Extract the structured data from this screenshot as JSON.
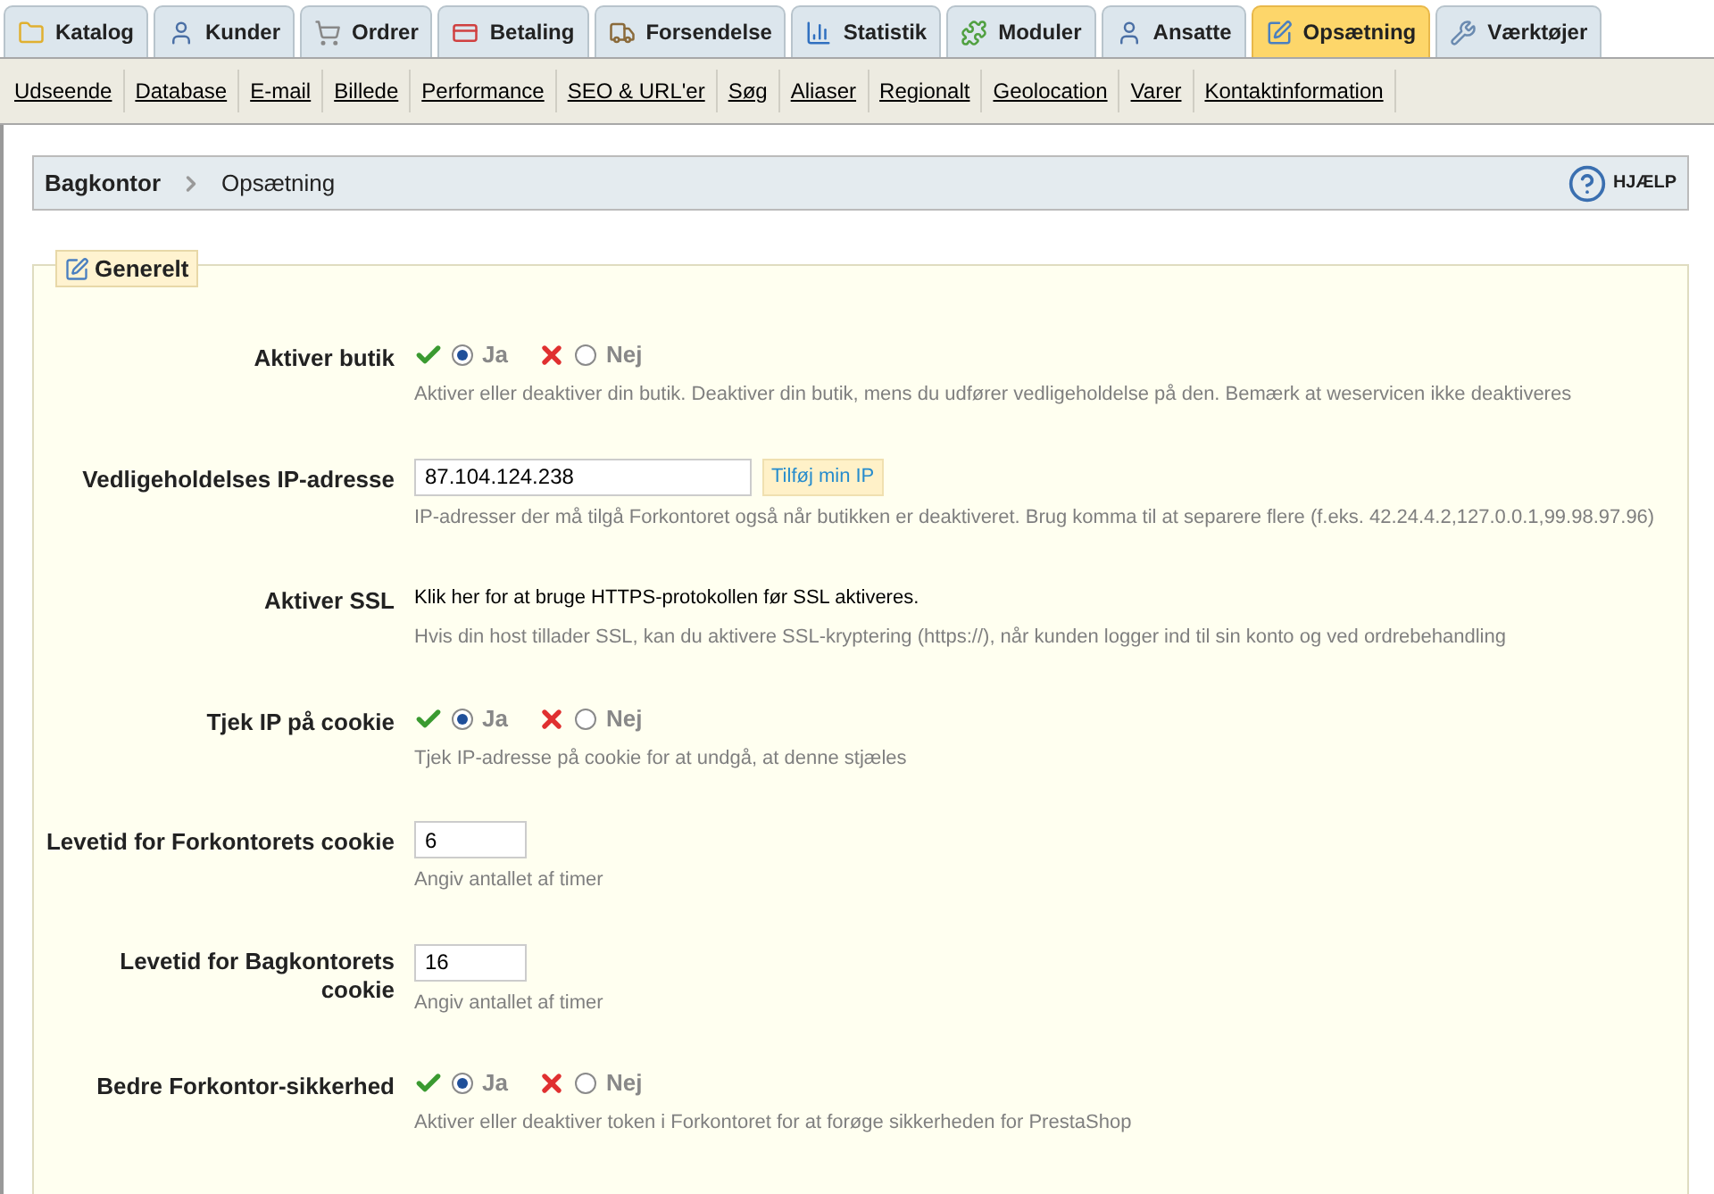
{
  "tabs": [
    {
      "label": "Katalog",
      "kind": "folder",
      "selected": false
    },
    {
      "label": "Kunder",
      "kind": "user",
      "selected": false
    },
    {
      "label": "Ordrer",
      "kind": "cart",
      "selected": false
    },
    {
      "label": "Betaling",
      "kind": "card",
      "selected": false
    },
    {
      "label": "Forsendelse",
      "kind": "truck",
      "selected": false
    },
    {
      "label": "Statistik",
      "kind": "chart",
      "selected": false
    },
    {
      "label": "Moduler",
      "kind": "puzzle",
      "selected": false
    },
    {
      "label": "Ansatte",
      "kind": "user",
      "selected": false
    },
    {
      "label": "Opsætning",
      "kind": "edit",
      "selected": true
    },
    {
      "label": "Værktøjer",
      "kind": "wrench",
      "selected": false
    }
  ],
  "subnav": [
    "Udseende",
    "Database",
    "E-mail",
    "Billede",
    "Performance",
    "SEO & URL'er",
    "Søg",
    "Aliaser",
    "Regionalt",
    "Geolocation",
    "Varer",
    "Kontaktinformation"
  ],
  "breadcrumb": {
    "root": "Bagkontor",
    "current": "Opsætning",
    "help": "HJÆLP"
  },
  "fieldset": {
    "legend": "Generelt",
    "rows": [
      {
        "kind": "toggle",
        "label": "Aktiver butik",
        "yes": "Ja",
        "no": "Nej",
        "on": true,
        "hint": "Aktiver eller deaktiver din butik. Deaktiver din butik, mens du udfører vedligeholdelse på den. Bemærk at weservicen ikke deaktiveres"
      },
      {
        "kind": "ip",
        "label": "Vedligeholdelses IP-adresse",
        "value": "87.104.124.238",
        "button": "Tilføj min IP",
        "hint": "IP-adresser der må tilgå Forkontoret også når butikken er deaktiveret. Brug komma til at separere flere (f.eks. 42.24.4.2,127.0.0.1,99.98.97.96)"
      },
      {
        "kind": "link",
        "label": "Aktiver SSL",
        "link": "Klik her for at bruge HTTPS-protokollen før SSL aktiveres.",
        "hint": "Hvis din host tillader SSL, kan du aktivere SSL-kryptering (https://), når kunden logger ind til sin konto og ved ordrebehandling"
      },
      {
        "kind": "toggle",
        "label": "Tjek IP på cookie",
        "yes": "Ja",
        "no": "Nej",
        "on": true,
        "hint": "Tjek IP-adresse på cookie for at undgå, at denne stjæles"
      },
      {
        "kind": "number",
        "label": "Levetid for Forkontorets cookie",
        "value": "6",
        "hint": "Angiv antallet af timer"
      },
      {
        "kind": "number",
        "label": "Levetid for Bagkontorets cookie",
        "value": "16",
        "hint": "Angiv antallet af timer"
      },
      {
        "kind": "toggle",
        "label": "Bedre Forkontor-sikkerhed",
        "yes": "Ja",
        "no": "Nej",
        "on": true,
        "hint": "Aktiver eller deaktiver token i Forkontoret for at forøge sikkerheden for PrestaShop"
      }
    ]
  }
}
